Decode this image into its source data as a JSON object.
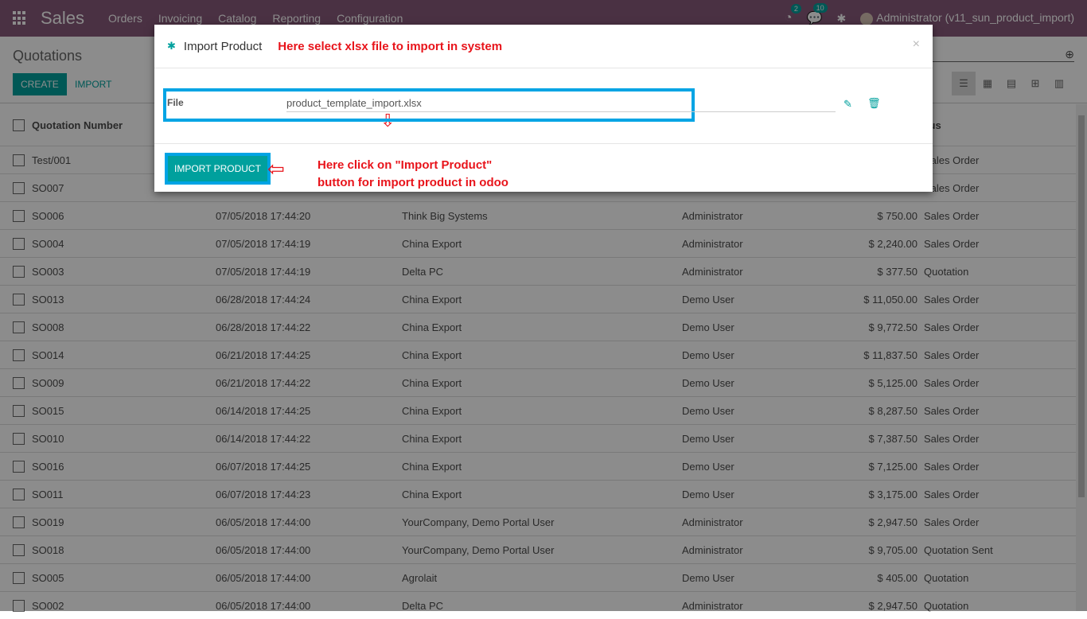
{
  "topbar": {
    "app": "Sales",
    "menu": [
      "Orders",
      "Invoicing",
      "Catalog",
      "Reporting",
      "Configuration"
    ],
    "activity_count": "2",
    "messages_count": "10",
    "user": "Administrator (v11_sun_product_import)"
  },
  "control": {
    "title": "Quotations",
    "create": "CREATE",
    "import": "IMPORT"
  },
  "list": {
    "headers": {
      "number": "Quotation Number",
      "status": "Status"
    },
    "rows": [
      {
        "n": "Test/001",
        "d": "",
        "c": "",
        "s": "",
        "t": "",
        "st": "Sales Order"
      },
      {
        "n": "SO007",
        "d": "",
        "c": "",
        "s": "",
        "t": "",
        "st": "Sales Order"
      },
      {
        "n": "SO006",
        "d": "07/05/2018 17:44:20",
        "c": "Think Big Systems",
        "s": "Administrator",
        "t": "$ 750.00",
        "st": "Sales Order"
      },
      {
        "n": "SO004",
        "d": "07/05/2018 17:44:19",
        "c": "China Export",
        "s": "Administrator",
        "t": "$ 2,240.00",
        "st": "Sales Order"
      },
      {
        "n": "SO003",
        "d": "07/05/2018 17:44:19",
        "c": "Delta PC",
        "s": "Administrator",
        "t": "$ 377.50",
        "st": "Quotation"
      },
      {
        "n": "SO013",
        "d": "06/28/2018 17:44:24",
        "c": "China Export",
        "s": "Demo User",
        "t": "$ 11,050.00",
        "st": "Sales Order"
      },
      {
        "n": "SO008",
        "d": "06/28/2018 17:44:22",
        "c": "China Export",
        "s": "Demo User",
        "t": "$ 9,772.50",
        "st": "Sales Order"
      },
      {
        "n": "SO014",
        "d": "06/21/2018 17:44:25",
        "c": "China Export",
        "s": "Demo User",
        "t": "$ 11,837.50",
        "st": "Sales Order"
      },
      {
        "n": "SO009",
        "d": "06/21/2018 17:44:22",
        "c": "China Export",
        "s": "Demo User",
        "t": "$ 5,125.00",
        "st": "Sales Order"
      },
      {
        "n": "SO015",
        "d": "06/14/2018 17:44:25",
        "c": "China Export",
        "s": "Demo User",
        "t": "$ 8,287.50",
        "st": "Sales Order"
      },
      {
        "n": "SO010",
        "d": "06/14/2018 17:44:22",
        "c": "China Export",
        "s": "Demo User",
        "t": "$ 7,387.50",
        "st": "Sales Order"
      },
      {
        "n": "SO016",
        "d": "06/07/2018 17:44:25",
        "c": "China Export",
        "s": "Demo User",
        "t": "$ 7,125.00",
        "st": "Sales Order"
      },
      {
        "n": "SO011",
        "d": "06/07/2018 17:44:23",
        "c": "China Export",
        "s": "Demo User",
        "t": "$ 3,175.00",
        "st": "Sales Order"
      },
      {
        "n": "SO019",
        "d": "06/05/2018 17:44:00",
        "c": "YourCompany, Demo Portal User",
        "s": "Administrator",
        "t": "$ 2,947.50",
        "st": "Sales Order"
      },
      {
        "n": "SO018",
        "d": "06/05/2018 17:44:00",
        "c": "YourCompany, Demo Portal User",
        "s": "Administrator",
        "t": "$ 9,705.00",
        "st": "Quotation Sent"
      },
      {
        "n": "SO005",
        "d": "06/05/2018 17:44:00",
        "c": "Agrolait",
        "s": "Demo User",
        "t": "$ 405.00",
        "st": "Quotation"
      },
      {
        "n": "SO002",
        "d": "06/05/2018 17:44:00",
        "c": "Delta PC",
        "s": "Administrator",
        "t": "$ 2,947.50",
        "st": "Quotation"
      }
    ]
  },
  "modal": {
    "title": "Import Product",
    "annotation_top": "Here select xlsx file to import in system",
    "file_label": "File",
    "file_value": "product_template_import.xlsx",
    "button": "IMPORT PRODUCT",
    "annotation_bottom_1": "Here click on \"Import Product\"",
    "annotation_bottom_2": "button for import product in odoo"
  }
}
